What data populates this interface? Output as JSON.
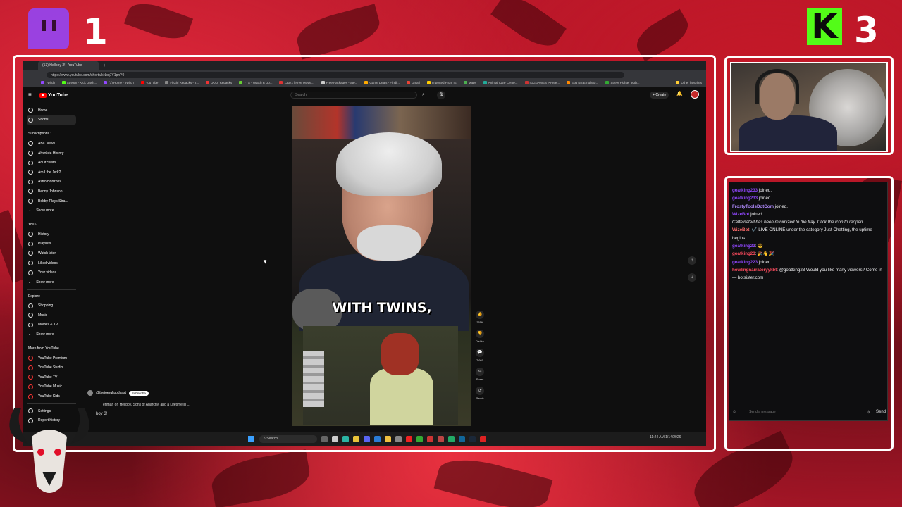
{
  "overlay": {
    "left_score": "1",
    "right_score": "3",
    "k_letter": "K"
  },
  "browser": {
    "tab_title": "(13) Hellboy 3! - YouTube",
    "url": "https://www.youtube.com/shorts/kNbq7Y1pnY0",
    "bookmarks": [
      "Twitch",
      "Stream - Kick Dash...",
      "(1) Home - Twitch",
      "YouTube",
      "FitGirl Repacks - T...",
      "DODI Repacks",
      "YTS - Watch & Do...",
      "1337x | Free Movie...",
      "Free Packages - Ste...",
      "Game Deals - Findi...",
      "Gmail",
      "Imported From IE",
      "Maps",
      "Animal Care Cente...",
      "IGGGAMES > Free...",
      "Egg NS Emulator...",
      "Street Fighter 30th..."
    ],
    "bookmarks_other": "Other favorites"
  },
  "youtube": {
    "logo": "YouTube",
    "search_placeholder": "Search",
    "create_label": "Create",
    "sidebar": {
      "home": "Home",
      "shorts": "Shorts",
      "subscriptions": "Subscriptions",
      "subs": [
        "ABC News",
        "Absolute History",
        "Adult Swim",
        "Am I the Jerk?",
        "Astro Horizons",
        "Benny Johnson",
        "Bobby Plays Stra..."
      ],
      "show_more": "Show more",
      "you": "You",
      "you_items": [
        "History",
        "Playlists",
        "Watch later",
        "Liked videos",
        "Your videos"
      ],
      "explore": "Explore",
      "explore_items": [
        "Shopping",
        "Music",
        "Movies & TV"
      ],
      "more_from": "More from YouTube",
      "more_items": [
        "YouTube Premium",
        "YouTube Studio",
        "YouTube TV",
        "YouTube Music",
        "YouTube Kids"
      ],
      "settings": "Settings",
      "report": "Report history"
    },
    "short": {
      "caption": "WITH TWINS,",
      "channel": "@thejoerulipodcast",
      "subscribe": "Subscribe",
      "title": "erlman on Hellboy, Sons of Anarchy, and a Lifetime in ...",
      "title_big": "boy 3!",
      "likes": "355K",
      "dislike": "Dislike",
      "comments": "7,660",
      "share": "Share",
      "remix": "Remix"
    }
  },
  "taskbar": {
    "search": "Search",
    "time": "11:24 AM",
    "date": "1/14/2026"
  },
  "chat": {
    "messages": [
      {
        "user": "goatking233",
        "text": " joined.",
        "cls": "u"
      },
      {
        "user": "goatking233",
        "text": " joined.",
        "cls": "u"
      },
      {
        "user": "FrostyToolsDotCom",
        "text": " joined.",
        "cls": "u2"
      },
      {
        "user": "WizeBot",
        "text": " joined.",
        "cls": "u"
      },
      {
        "user": "",
        "text": "Caffeinated has been minimized to the tray. Click the icon to reopen.",
        "cls": "it"
      },
      {
        "user": "WizeBot",
        "text": ": ✔️ LIVE ONLINE under the category Just Chatting, the uptime begins.",
        "cls": "u3"
      },
      {
        "user": "goatking23",
        "text": ": 😎",
        "cls": "u"
      },
      {
        "user": "goatking23",
        "text": ": 🎉👋🎉",
        "cls": "u4"
      },
      {
        "user": "goatking223",
        "text": " joined.",
        "cls": "u"
      },
      {
        "user": "howlingnarratoryykbt",
        "text": ": @goatking23 Would you like many viewers? Come in — botsister.com",
        "cls": "u4"
      }
    ],
    "input_placeholder": "Send a message",
    "send": "Send"
  },
  "colors": {
    "accent_red": "#b3172a",
    "youtube_red": "#ff0000",
    "twitch_purple": "#9147ff",
    "kick_green": "#53fc18"
  }
}
